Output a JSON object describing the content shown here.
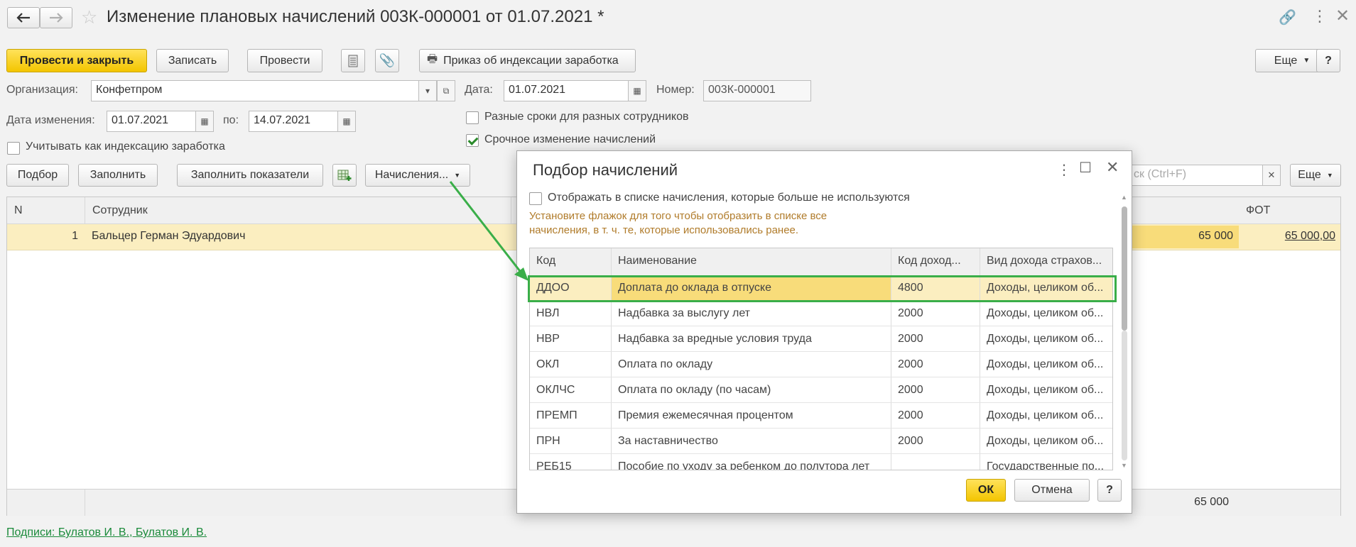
{
  "window": {
    "title": "Изменение плановых начислений 003К-000001 от 01.07.2021 *"
  },
  "toolbar": {
    "post_close": "Провести и закрыть",
    "save": "Записать",
    "post": "Провести",
    "order": "Приказ об индексации заработка",
    "more": "Еще",
    "help": "?"
  },
  "form": {
    "org_label": "Организация:",
    "org_value": "Конфетпром",
    "date_label": "Дата:",
    "date_value": "01.07.2021",
    "number_label": "Номер:",
    "number_value": "003К-000001",
    "change_date_label": "Дата изменения:",
    "change_date_from": "01.07.2021",
    "to_label": "по:",
    "change_date_to": "14.07.2021",
    "diff_terms_label": "Разные сроки для разных сотрудников",
    "diff_terms_checked": false,
    "urgent_label": "Срочное изменение начислений",
    "urgent_checked": true,
    "indexation_label": "Учитывать как индексацию заработка",
    "indexation_checked": false
  },
  "table_toolbar": {
    "pick": "Подбор",
    "fill": "Заполнить",
    "fill_indicators": "Заполнить показатели",
    "accruals": "Начисления...",
    "search_placeholder": "Поиск (Ctrl+F)",
    "search_visible": "ск (Ctrl+F)",
    "more": "Еще"
  },
  "main_table": {
    "columns": [
      "N",
      "Сотрудник",
      "ФОТ"
    ],
    "rows": [
      {
        "n": "1",
        "employee": "Бальцер Герман Эдуардович",
        "amount": "65 000",
        "fot": "65 000,00"
      }
    ],
    "footer_total": "65 000"
  },
  "signatures": "Подписи: Булатов И. В., Булатов И. В.",
  "dialog": {
    "title": "Подбор начислений",
    "show_unused_label": "Отображать в списке начисления, которые больше не используются",
    "show_unused_checked": false,
    "hint_line1": "Установите флажок для того чтобы отобразить в списке все",
    "hint_line2": "начисления, в т. ч. те, которые использовались ранее.",
    "columns": [
      "Код",
      "Наименование",
      "Код доход...",
      "Вид дохода страхов..."
    ],
    "rows": [
      {
        "code": "ДДОО",
        "name": "Доплата до оклада в отпуске",
        "income_code": "4800",
        "income_type": "Доходы, целиком об..."
      },
      {
        "code": "НВЛ",
        "name": "Надбавка за выслугу лет",
        "income_code": "2000",
        "income_type": "Доходы, целиком об..."
      },
      {
        "code": "НВР",
        "name": "Надбавка за вредные условия труда",
        "income_code": "2000",
        "income_type": "Доходы, целиком об..."
      },
      {
        "code": "ОКЛ",
        "name": "Оплата по окладу",
        "income_code": "2000",
        "income_type": "Доходы, целиком об..."
      },
      {
        "code": "ОКЛЧС",
        "name": "Оплата по окладу (по часам)",
        "income_code": "2000",
        "income_type": "Доходы, целиком об..."
      },
      {
        "code": "ПРЕМП",
        "name": "Премия ежемесячная процентом",
        "income_code": "2000",
        "income_type": "Доходы, целиком об..."
      },
      {
        "code": "ПРН",
        "name": "За наставничество",
        "income_code": "2000",
        "income_type": "Доходы, целиком об..."
      },
      {
        "code": "РЕБ15",
        "name": "Пособие по уходу за ребенком до полутора лет",
        "income_code": "",
        "income_type": "Государственные по..."
      }
    ],
    "ok": "ОК",
    "cancel": "Отмена",
    "help": "?"
  },
  "colors": {
    "accent_yellow": "#f3c500",
    "highlight_green": "#3aae49",
    "link_green": "#1a8a3a",
    "selected_row": "#fbeec0",
    "hint_text": "#b07b2a"
  }
}
